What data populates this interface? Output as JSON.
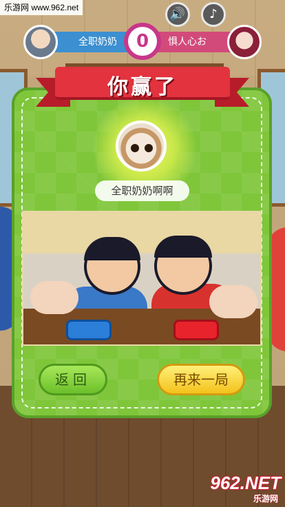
{
  "watermark_top": "乐游网 www.962.net",
  "watermark_bottom": {
    "logo": "962.NET",
    "caption": "乐游网"
  },
  "header": {
    "score": "0",
    "player_left": "全职奶奶",
    "player_right": "惧人心お",
    "sound_icon": "speaker-icon",
    "music_icon": "music-note-icon"
  },
  "dialog": {
    "title": "你赢了",
    "winner_name": "全职奶奶啊啊",
    "back_label": "返回",
    "again_label": "再来一局"
  },
  "colors": {
    "panel_green": "#7fc63a",
    "ribbon_red": "#e2333f",
    "score_magenta": "#c8378a",
    "left_blue": "#3c8fd0",
    "right_pink": "#d24a7a"
  }
}
